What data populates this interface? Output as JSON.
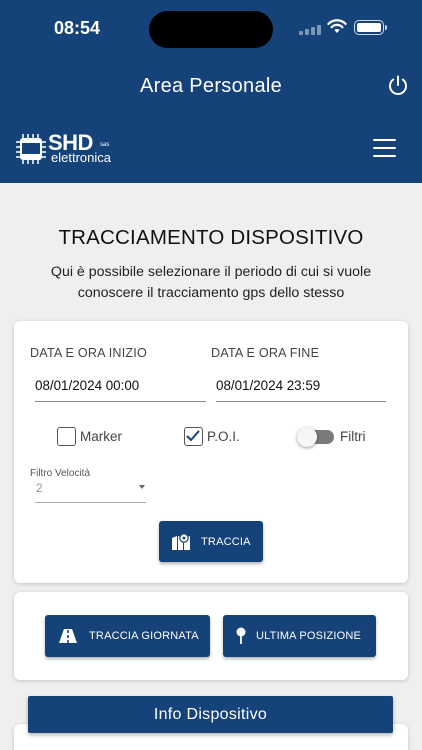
{
  "status_bar": {
    "time": "08:54"
  },
  "header": {
    "title": "Area Personale",
    "logo": {
      "brand": "SHD",
      "suffix": "sas",
      "subtitle": "elettronica"
    }
  },
  "page": {
    "title": "TRACCIAMENTO DISPOSITIVO",
    "description": "Qui è possibile selezionare il periodo di cui si vuole conoscere il tracciamento gps dello stesso"
  },
  "form": {
    "start": {
      "label": "DATA E ORA INIZIO",
      "value": "08/01/2024 00:00"
    },
    "end": {
      "label": "DATA E ORA FINE",
      "value": "08/01/2024 23:59"
    },
    "marker": {
      "label": "Marker",
      "checked": false
    },
    "poi": {
      "label": "P.O.I.",
      "checked": true
    },
    "filtri": {
      "label": "Filtri",
      "on": false
    },
    "speed_filter": {
      "label": "Filtro Velocità",
      "value": "2"
    },
    "track_button": "TRACCIA"
  },
  "actions": {
    "track_day": "TRACCIA GIORNATA",
    "last_position": "ULTIMA POSIZIONE"
  },
  "info": {
    "label": "Info Dispositivo"
  },
  "colors": {
    "primary": "#16427a",
    "background": "#efefef",
    "card": "#ffffff"
  }
}
